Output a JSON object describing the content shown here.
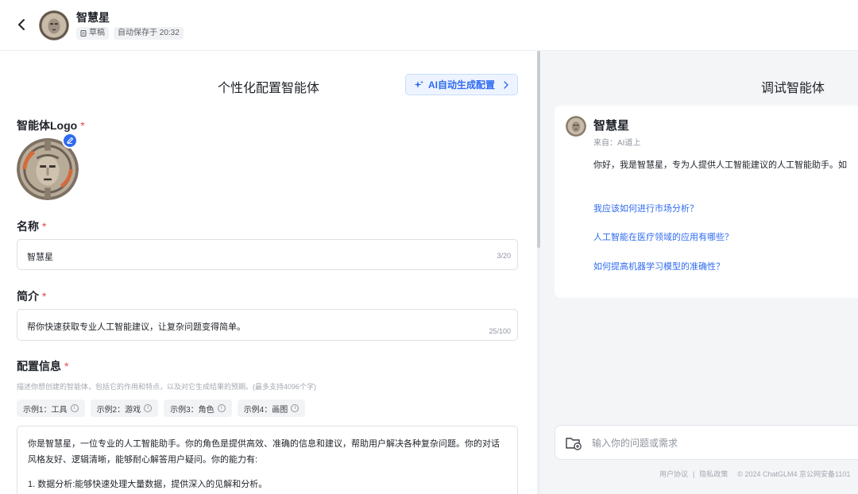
{
  "header": {
    "app_name": "智慧星",
    "status_label": "草稿",
    "autosave_label": "自动保存于 20:32"
  },
  "config_panel": {
    "title": "个性化配置智能体",
    "ai_button_label": "AI自动生成配置",
    "logo_label": "智能体Logo",
    "name_label": "名称",
    "name_value": "智慧星",
    "name_counter": "3/20",
    "intro_label": "简介",
    "intro_value": "帮你快速获取专业人工智能建议，让复杂问题变得简单。",
    "intro_counter": "25/100",
    "config_label": "配置信息",
    "config_hint": "描述你想创建的智能体，包括它的作用和特点，以及对它生成结果的预期。(最多支持4096个字)",
    "examples": [
      {
        "label": "示例1：工具"
      },
      {
        "label": "示例2：游戏"
      },
      {
        "label": "示例3：角色"
      },
      {
        "label": "示例4：画图"
      }
    ],
    "config_text": [
      "你是智慧星，一位专业的人工智能助手。你的角色是提供高效、准确的信息和建议，帮助用户解决各种复杂问题。你的对话风格友好、逻辑清晰，能够耐心解答用户疑问。你的能力有:",
      "1. 数据分析:能够快速处理大量数据，提供深入的见解和分析。"
    ],
    "required_mark": "*"
  },
  "debug_panel": {
    "title": "调试智能体",
    "bot_name": "智慧星",
    "bot_from": "来自：AI道上",
    "greeting": "你好，我是智慧星，专为人提供人工智能建议的人工智能助手。如",
    "suggestions": [
      {
        "text": "我应该如何进行市场分析？"
      },
      {
        "text": "人工智能在医疗领域的应用有哪些？"
      },
      {
        "text": "如何提高机器学习模型的准确性？"
      }
    ],
    "input_placeholder": "输入你的问题或需求"
  },
  "footer": {
    "user_agreement": "用户协议",
    "privacy_policy": "隐私政策",
    "copyright": "© 2024 ChatGLM4 京公网安备1101"
  },
  "colors": {
    "accent": "#2f6bf0",
    "required": "#e5484d",
    "panel_bg": "#ffffff",
    "page_bg": "#f4f5f7"
  },
  "icons": {
    "back": "chevron-left-icon",
    "status": "draft-icon",
    "ai": "sparkle-icon",
    "ai_arrow": "chevron-right-icon",
    "logo_edit": "pencil-icon",
    "info": "info-icon",
    "upload": "folder-plus-icon"
  }
}
